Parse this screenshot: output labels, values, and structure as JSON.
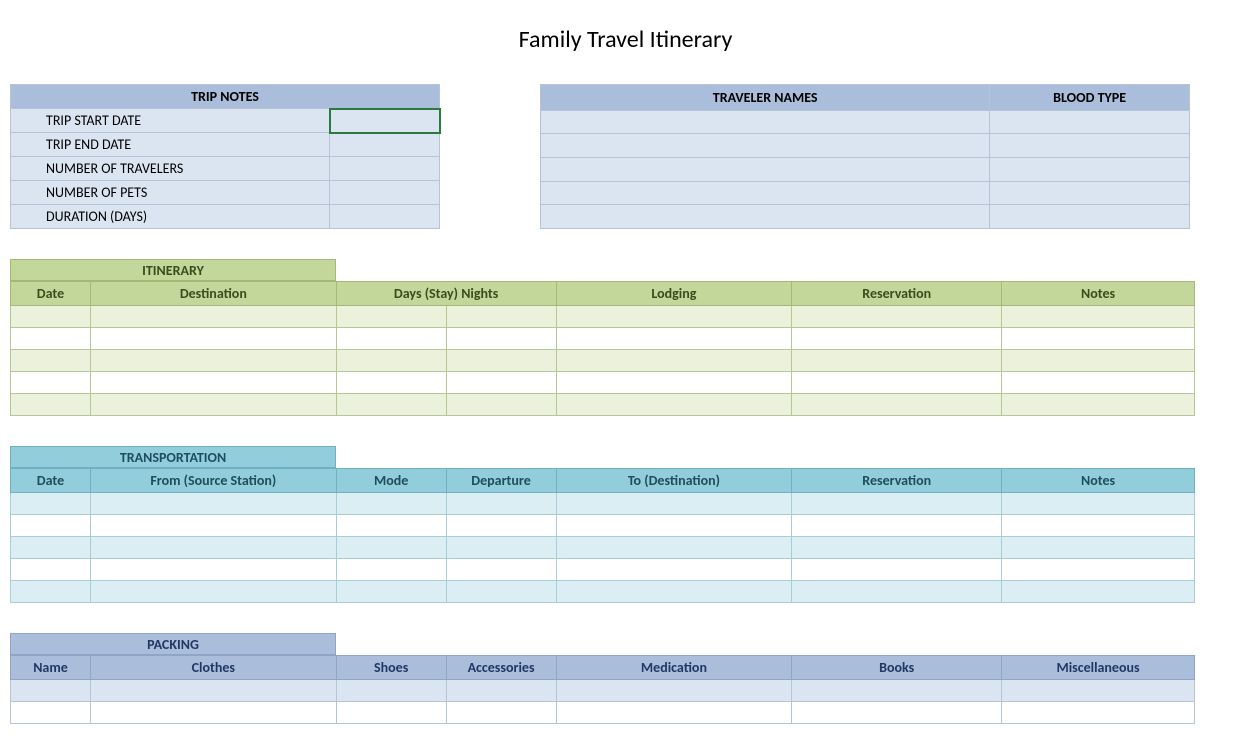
{
  "title": "Family Travel Itinerary",
  "tripnotes": {
    "header": "TRIP NOTES",
    "rows": [
      {
        "label": "TRIP START DATE",
        "value": ""
      },
      {
        "label": "TRIP END DATE",
        "value": ""
      },
      {
        "label": "NUMBER OF TRAVELERS",
        "value": ""
      },
      {
        "label": "NUMBER OF PETS",
        "value": ""
      },
      {
        "label": "DURATION (DAYS)",
        "value": ""
      }
    ],
    "selected_row": 0
  },
  "travelers": {
    "header_name": "TRAVELER NAMES",
    "header_blood": "BLOOD TYPE",
    "rows": [
      {
        "name": "",
        "blood": ""
      },
      {
        "name": "",
        "blood": ""
      },
      {
        "name": "",
        "blood": ""
      },
      {
        "name": "",
        "blood": ""
      },
      {
        "name": "",
        "blood": ""
      }
    ]
  },
  "itinerary": {
    "title": "ITINERARY",
    "columns": [
      "Date",
      "Destination",
      "Days (Stay) Nights",
      "Lodging",
      "Reservation",
      "Notes"
    ],
    "rows": [
      [
        "",
        "",
        "",
        "",
        "",
        "",
        ""
      ],
      [
        "",
        "",
        "",
        "",
        "",
        "",
        ""
      ],
      [
        "",
        "",
        "",
        "",
        "",
        "",
        ""
      ],
      [
        "",
        "",
        "",
        "",
        "",
        "",
        ""
      ],
      [
        "",
        "",
        "",
        "",
        "",
        "",
        ""
      ]
    ]
  },
  "transportation": {
    "title": "TRANSPORTATION",
    "columns": [
      "Date",
      "From (Source Station)",
      "Mode",
      "Departure",
      "To (Destination)",
      "Reservation",
      "Notes"
    ],
    "rows": [
      [
        "",
        "",
        "",
        "",
        "",
        "",
        ""
      ],
      [
        "",
        "",
        "",
        "",
        "",
        "",
        ""
      ],
      [
        "",
        "",
        "",
        "",
        "",
        "",
        ""
      ],
      [
        "",
        "",
        "",
        "",
        "",
        "",
        ""
      ],
      [
        "",
        "",
        "",
        "",
        "",
        "",
        ""
      ]
    ]
  },
  "packing": {
    "title": "PACKING",
    "columns": [
      "Name",
      "Clothes",
      "Shoes",
      "Accessories",
      "Medication",
      "Books",
      "Miscellaneous"
    ],
    "rows": [
      [
        "",
        "",
        "",
        "",
        "",
        "",
        ""
      ],
      [
        "",
        "",
        "",
        "",
        "",
        "",
        ""
      ]
    ]
  }
}
